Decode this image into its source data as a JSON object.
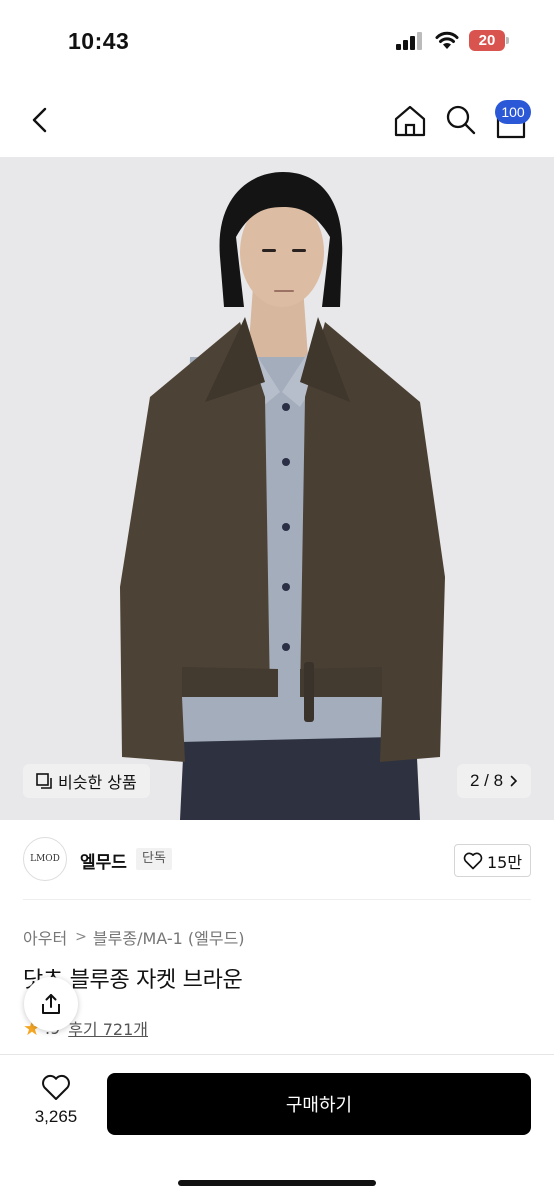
{
  "status_bar": {
    "time": "10:43",
    "battery_level": "20",
    "battery_color": "#d9534f",
    "icons": [
      "signal-icon",
      "wifi-icon",
      "battery-icon"
    ]
  },
  "nav": {
    "icons": [
      "back-arrow-icon",
      "home-icon",
      "search-icon",
      "cart-icon"
    ],
    "cart_count": "100",
    "badge_color": "#2b58d6"
  },
  "gallery": {
    "similar_label": "비슷한 상품",
    "counter": "2 / 8"
  },
  "brand": {
    "logo_text": "LMOD",
    "name": "엘무드",
    "badge": "단독",
    "likes": "15만"
  },
  "product": {
    "breadcrumb": [
      "아우터",
      "블루종/MA-1 (엘무드)"
    ],
    "title": "닷츠 블루종 자켓 브라운",
    "rating": ".9",
    "reviews": "후기 721개"
  },
  "bottom_bar": {
    "wish_count": "3,265",
    "buy_label": "구매하기"
  }
}
